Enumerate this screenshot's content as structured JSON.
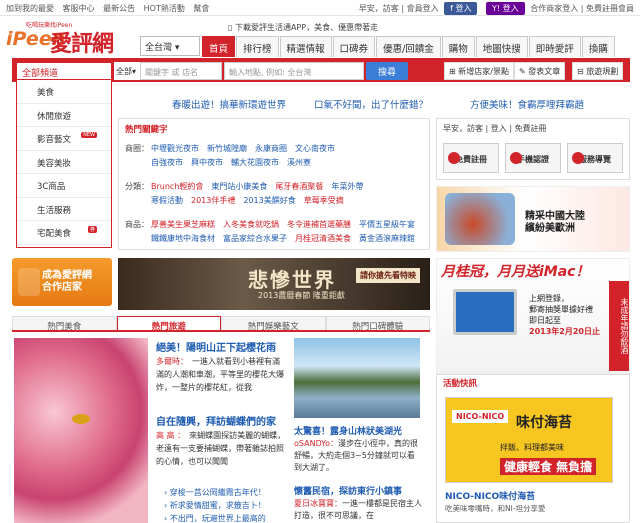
{
  "topbar": {
    "left_links": [
      "加到我的最愛",
      "客服中心",
      "最新公告",
      "HOT熱活動",
      "幫會"
    ],
    "greeting": "早安，訪客",
    "member_login": "會員登入",
    "fb_login": "登入",
    "yahoo_login": "登入",
    "partner": "合作商家登入",
    "register": "免費註冊會員"
  },
  "logo": {
    "text_en": "iPeen",
    "text_zh": "愛評網",
    "tag": "吃喝玩樂找iPeen"
  },
  "app_note": "下載愛評生活通APP，美食、優惠帶著走",
  "region_select": "全台灣",
  "nav_tabs": [
    "首頁",
    "排行榜",
    "精選情報",
    "口碑券",
    "優惠/回饋金",
    "購物",
    "地圖快搜",
    "即時愛評",
    "換購"
  ],
  "search": {
    "all_categories": "全部頻道",
    "category": "全部",
    "keyword_placeholder": "關鍵字 或 店名",
    "location_placeholder": "輸入地點, 例如: 全台灣",
    "button": "搜尋",
    "right_buttons": [
      "新增店家/景點",
      "發表文章",
      "旅遊規劃"
    ]
  },
  "categories": [
    {
      "label": "美食",
      "new": ""
    },
    {
      "label": "休閒旅遊",
      "new": ""
    },
    {
      "label": "影音藝文",
      "new": "NEW"
    },
    {
      "label": "美容美妝",
      "new": ""
    },
    {
      "label": "3C商品",
      "new": ""
    },
    {
      "label": "生活服務",
      "new": ""
    },
    {
      "label": "宅配美食",
      "new": "券"
    }
  ],
  "promos": [
    "春暖出遊！搞華新環遊世界",
    "口氣不好聞，出了什麼錯？",
    "方便美味！食霸厚哩拜霸趙"
  ],
  "hot": {
    "title": "熱門關鍵字",
    "rows": [
      {
        "label": "商圈：",
        "items": [
          "中壢觀光夜市",
          "新竹城隍廟",
          "永康商圈",
          "文心南夜市"
        ]
      },
      {
        "label": "",
        "items": [
          "自強夜市",
          "興中夜市",
          "輔大花園夜市",
          "溪州寮"
        ]
      },
      {
        "label": "分類：",
        "items": [
          "Brunch輕約會",
          "東門站小康美食",
          "尾牙春酒聚餐",
          "年菜外帶"
        ]
      },
      {
        "label": "",
        "items": [
          "寒假活動",
          "2013伴手禮",
          "2013美饌好食",
          "草莓季受摘"
        ]
      },
      {
        "label": "商品：",
        "items": [
          "厚善美生果芝麻糕",
          "入冬美食就吃鍋",
          "冬令進補首選藥膳",
          "平價五星級午宴"
        ]
      },
      {
        "label": "",
        "items": [
          "鐵鐵康地中海食材",
          "富品家綜合水果子",
          "月桂冠清酒美食",
          "黃金酒滾麻辣館"
        ]
      }
    ]
  },
  "user_box": {
    "greeting": "早安，訪客",
    "login": "登入",
    "register": "免費註冊",
    "buttons": [
      "免費註冊",
      "手機認證",
      "服務導覽"
    ]
  },
  "ad_china": {
    "line1": "精采中國大陸",
    "line2": "繽紛美歐洲"
  },
  "partner_ad": {
    "line1": "成為愛評網",
    "line2": "合作店家"
  },
  "movie_ad": {
    "title": "悲慘世界",
    "sub": "2013農曆春節 隆重鉅獻",
    "button": "請你搶先看特映"
  },
  "imac_ad": {
    "title": "月桂冠，月月送iMac！",
    "line1": "上網登錄，",
    "line2": "郵寄抽獎單據好禮",
    "line3": "即日起至",
    "line4": "2013年2月20日止",
    "side": "未成年請勿飲酒"
  },
  "content_tabs": [
    "熱門美食",
    "熱門旅遊",
    "熱門娛樂藝文",
    "熱門口碑體驗"
  ],
  "articles": {
    "a1": {
      "title": "絕美！陽明山正下起櫻花雨",
      "author": "多爾時：",
      "body": "一進入就看到小巷裡有滿滿的人潮和車潮，平等里的櫻花大爆炸，一整片的櫻花紅，從我"
    },
    "a2": {
      "title": "自在隨興，拜訪蝴蝶們的家",
      "author": "高 高 ：",
      "body": "來蝴蝶園探訪美麗的蝴蝶，老遠有一支要捕蝴蝶，帶著雜誌拍照的心情，也可以聞聞"
    },
    "bullets": [
      "穿梭一莒公岡繼霞古年代！",
      "祈求愛情甜蜜，求籤吉卜！",
      "不出門，玩遍世界上最高的"
    ],
    "a3": {
      "title": "太驚喜！露身山林狀美湖光",
      "author": "oSANDYo：",
      "body": "漫步在小徑中，真的很舒暢，大約走個3~5分鐘就可以看到大湖了。"
    },
    "a4": {
      "title": "懷舊民宿，探訪東行小鎮事",
      "author": "夏日冰寶寶：",
      "body": "一進一樓都是民宿主人打造，很不可思議，在"
    }
  },
  "events": {
    "title": "活動快訊",
    "ad_logo": "NICO-NICO",
    "ad_title": "味付海苔",
    "ad_sub": "拌飯、料理都美味",
    "ad_tag": "健康輕食 無負擔",
    "news_title": "NICO-NICO味付海苔",
    "news_body": "吃美味零嘴時，和NI-坦分享愛"
  }
}
